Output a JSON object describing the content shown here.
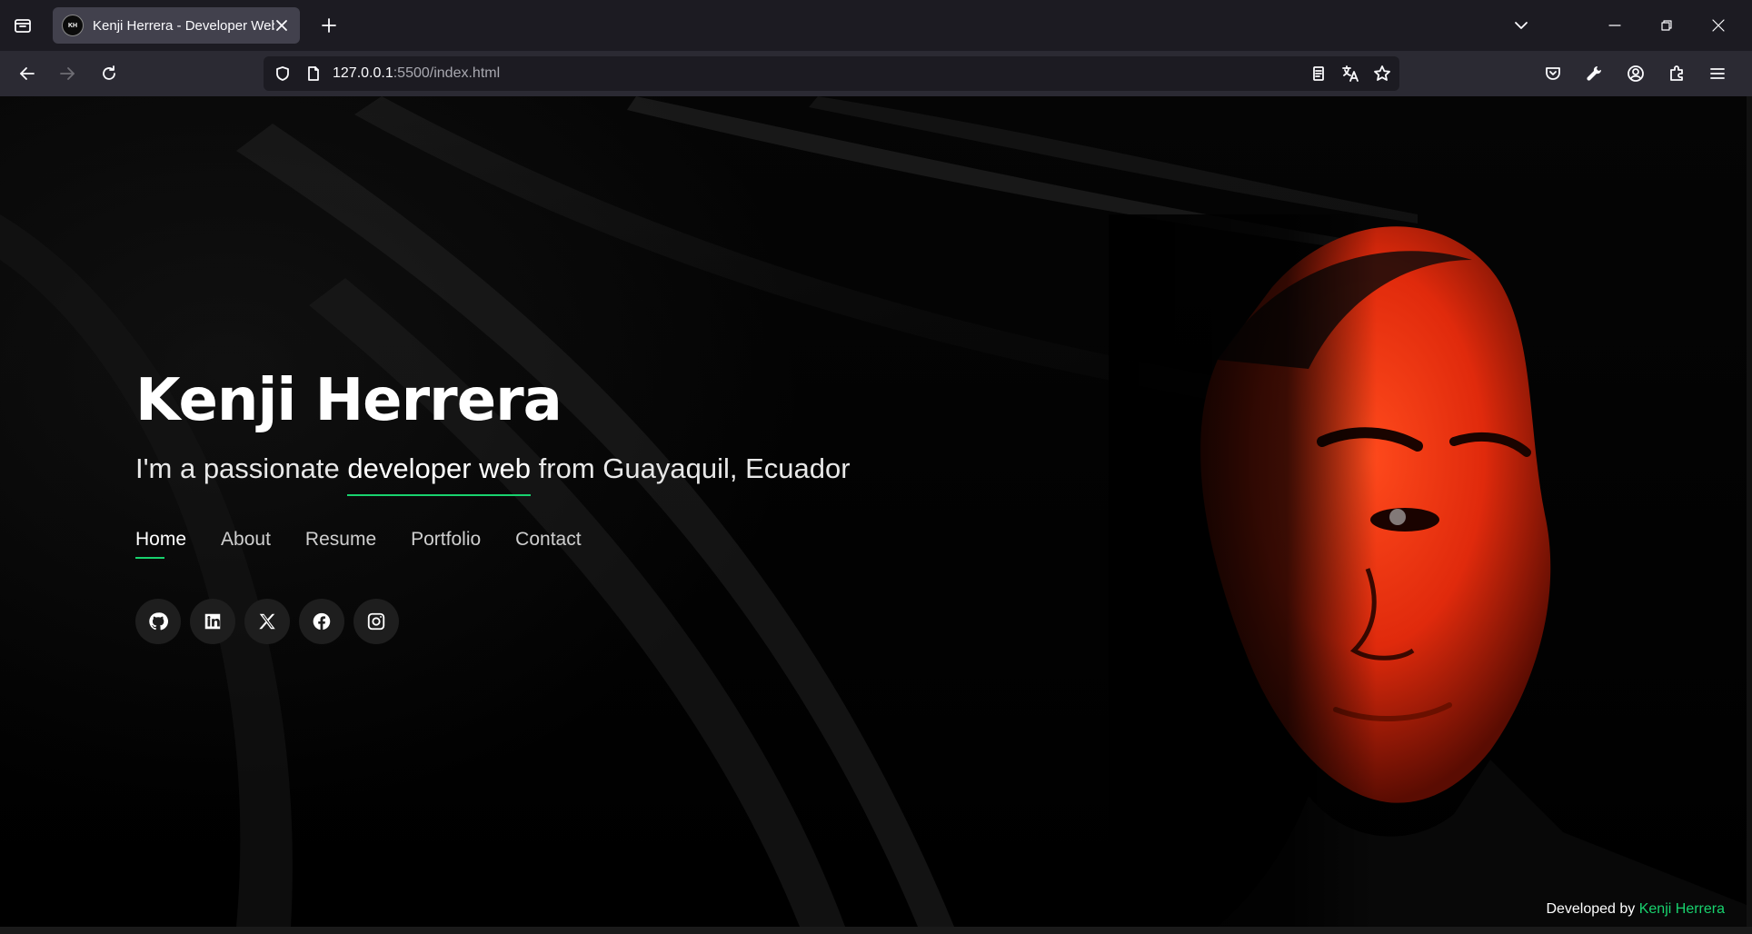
{
  "browser": {
    "tab": {
      "title": "Kenji Herrera - Developer Web",
      "favicon_text": "KH"
    },
    "url": {
      "host": "127.0.0.1",
      "rest": ":5500/index.html"
    },
    "icons": [
      "tab-list-icon",
      "close-icon",
      "new-tab-icon",
      "list-all-tabs-icon",
      "minimize-icon",
      "restore-icon",
      "window-close-icon",
      "back-icon",
      "forward-icon",
      "reload-icon",
      "shield-icon",
      "page-icon",
      "reader-view-icon",
      "translate-icon",
      "bookmark-star-icon",
      "pocket-icon",
      "wrench-icon",
      "account-icon",
      "extensions-icon",
      "menu-icon"
    ]
  },
  "hero": {
    "name": "Kenji Herrera",
    "subtitle_pre": "I'm a passionate ",
    "subtitle_highlight": "developer web",
    "subtitle_post": " from Guayaquil, Ecuador"
  },
  "nav": {
    "items": [
      {
        "label": "Home",
        "active": true
      },
      {
        "label": "About"
      },
      {
        "label": "Resume"
      },
      {
        "label": "Portfolio"
      },
      {
        "label": "Contact"
      }
    ]
  },
  "social": [
    "github-icon",
    "linkedin-icon",
    "x-twitter-icon",
    "facebook-icon",
    "instagram-icon"
  ],
  "footer": {
    "prefix": "Developed by ",
    "author": "Kenji Herrera"
  },
  "colors": {
    "accent": "#18d26e",
    "chrome_dark": "#1c1b22",
    "chrome_tab": "#42414d"
  }
}
